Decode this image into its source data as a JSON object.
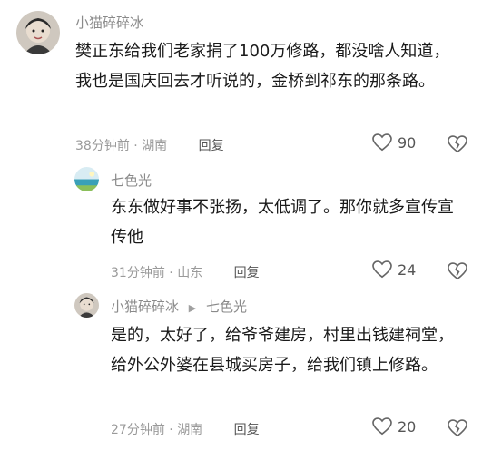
{
  "comments": [
    {
      "author": "小猫碎碎冰",
      "text": "樊正东给我们老家捐了100万修路，都没啥人知道，我也是国庆回去才听说的，金桥到祁东的那条路。",
      "time": "38分钟前",
      "location": "湖南",
      "reply_label": "回复",
      "likes": "90"
    },
    {
      "author": "七色光",
      "text": "东东做好事不张扬，太低调了。那你就多宣传宣传他",
      "time": "31分钟前",
      "location": "山东",
      "reply_label": "回复",
      "likes": "24"
    },
    {
      "author": "小猫碎碎冰",
      "reply_to": "七色光",
      "text": "是的，太好了，给爷爷建房，村里出钱建祠堂，给外公外婆在县城买房子，给我们镇上修路。",
      "time": "27分钟前",
      "location": "湖南",
      "reply_label": "回复",
      "likes": "20"
    }
  ],
  "meta_separator": "·",
  "colors": {
    "meta": "#9a9a9a",
    "name": "#8a8a8a",
    "text": "#1a1a1a"
  },
  "icons": {
    "like": "heart-outline-icon",
    "dislike": "broken-heart-icon"
  }
}
